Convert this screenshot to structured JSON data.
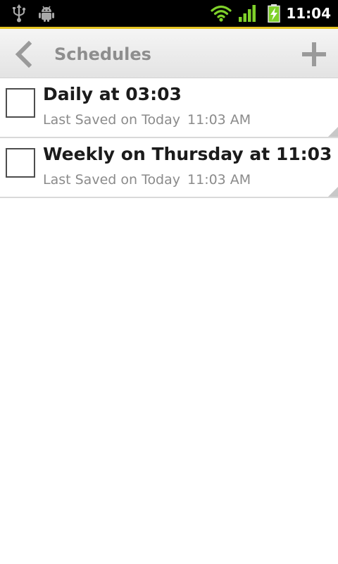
{
  "status_bar": {
    "time": "11:04",
    "icons": [
      "usb-icon",
      "android-debug-icon",
      "wifi-icon",
      "signal-icon",
      "battery-charging-icon"
    ],
    "accent_color": "#e5c422",
    "wifi_color": "#7fd12a"
  },
  "action_bar": {
    "title": "Schedules",
    "back_icon": "chevron-left-icon",
    "add_icon": "plus-icon"
  },
  "schedules": [
    {
      "title": "Daily at 03:03",
      "saved_label": "Last Saved on Today",
      "saved_time": "11:03 AM",
      "checked": false
    },
    {
      "title": "Weekly on Thursday at 11:03",
      "saved_label": "Last Saved on Today",
      "saved_time": "11:03 AM",
      "checked": false
    }
  ]
}
